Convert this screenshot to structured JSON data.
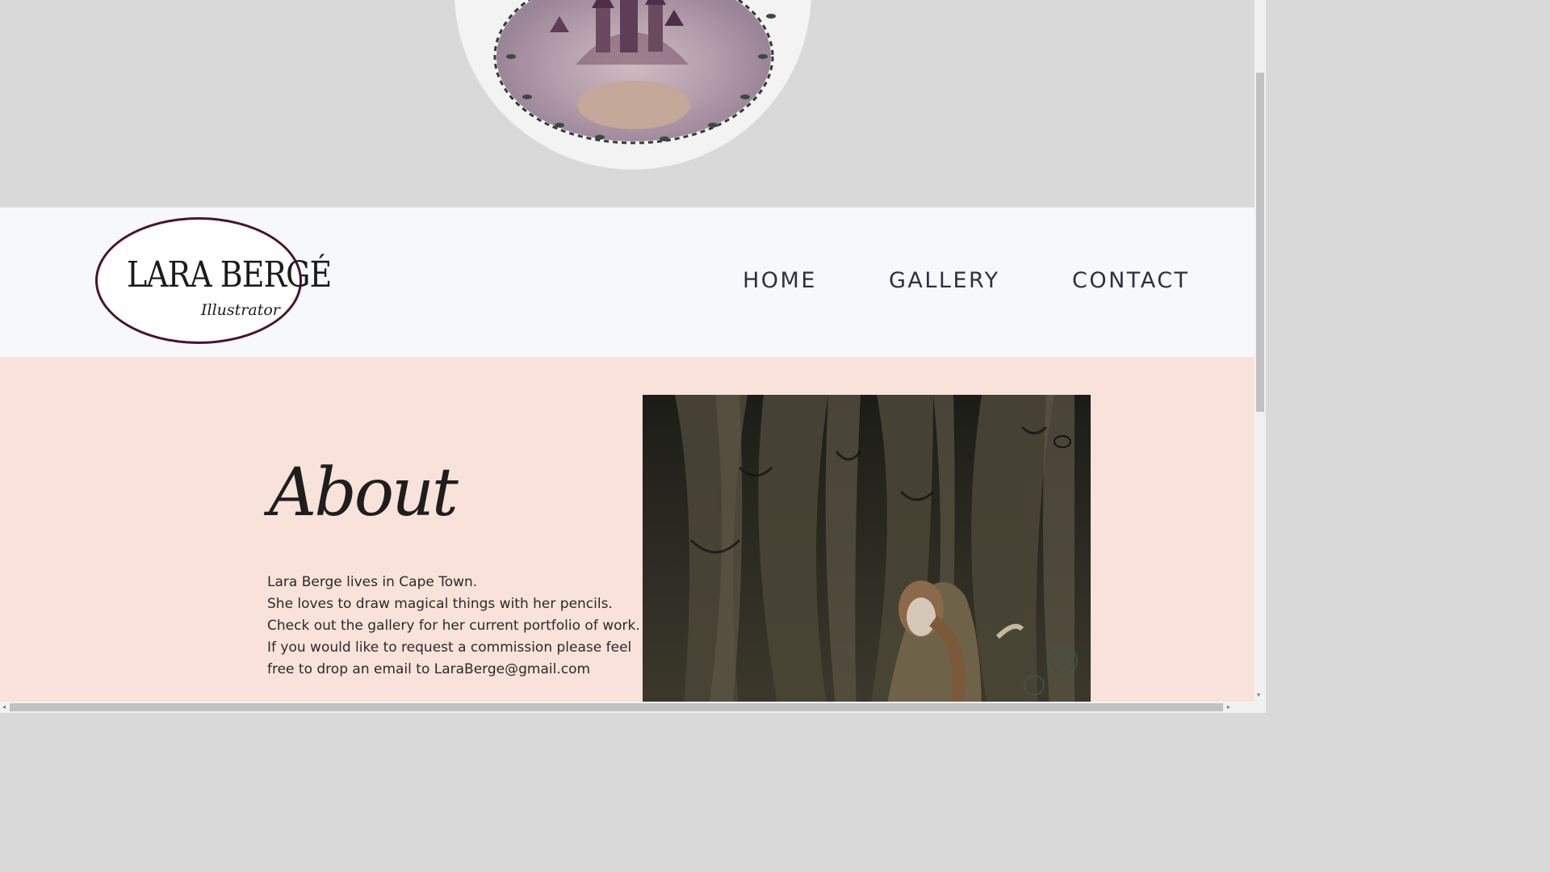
{
  "logo": {
    "name": "LARA BERGÉ",
    "subtitle": "Illustrator"
  },
  "nav": {
    "home": "HOME",
    "gallery": "GALLERY",
    "contact": "CONTACT"
  },
  "about": {
    "title": "About",
    "lines": [
      "Lara Berge lives in Cape Town.",
      "She loves to draw magical things with her pencils.",
      "Check out the gallery for her current portfolio of work.",
      "If you would like to request a commission please feel",
      "free to drop an email to LaraBerge@gmail.com"
    ]
  },
  "colors": {
    "hero_bg": "#d9d9d9",
    "navbar_bg": "#f7f8fa",
    "about_bg": "#f9e2d9",
    "logo_border": "#4a1230",
    "nav_text": "#2c3042"
  },
  "scrollbars": {
    "left_arrow": "◂",
    "right_arrow": "▸",
    "down_arrow": "▾"
  }
}
